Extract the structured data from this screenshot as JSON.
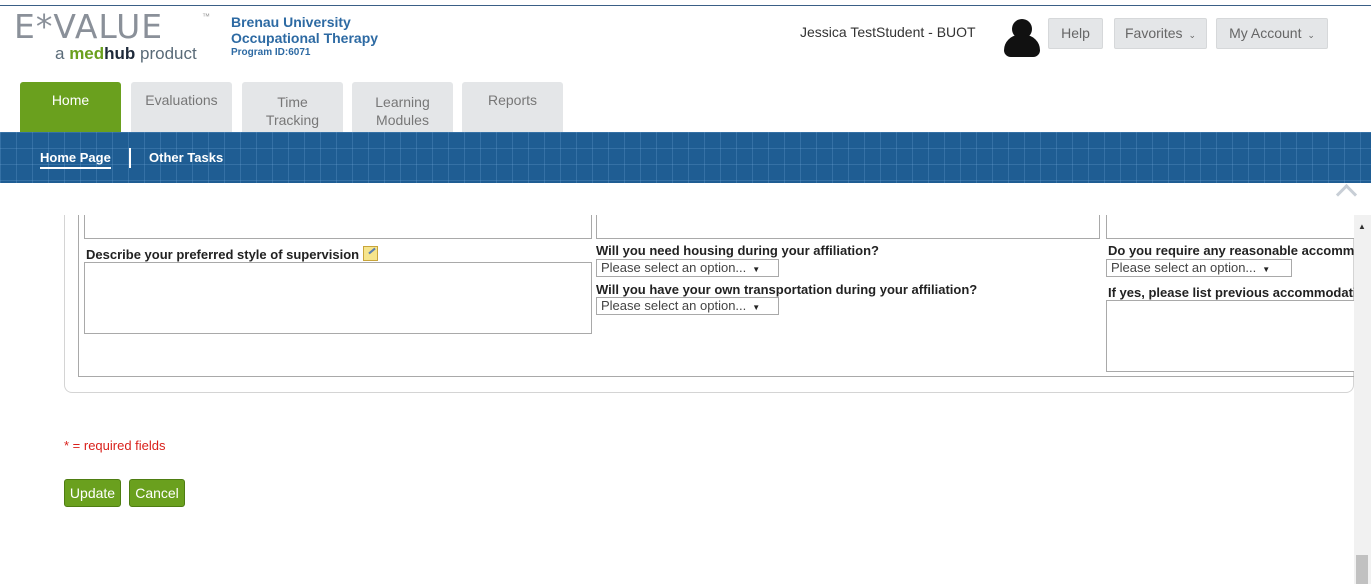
{
  "header": {
    "logo_main": "E*VALUE",
    "logo_tm": "™",
    "logo_sub_prefix": "a ",
    "logo_sub_med": "med",
    "logo_sub_hub": "hub",
    "logo_sub_suffix": " product",
    "program_line1": "Brenau University",
    "program_line2": "Occupational Therapy",
    "program_id": "Program ID:6071",
    "user_name": "Jessica TestStudent - BUOT",
    "help_label": "Help",
    "favorites_label": "Favorites",
    "account_label": "My Account",
    "chevron": "⌄"
  },
  "tabs": [
    {
      "line1": "Home",
      "line2": ""
    },
    {
      "line1": "Evaluations",
      "line2": ""
    },
    {
      "line1": "Time",
      "line2": "Tracking"
    },
    {
      "line1": "Learning",
      "line2": "Modules"
    },
    {
      "line1": "Reports",
      "line2": ""
    }
  ],
  "subnav": {
    "home_page": "Home Page",
    "other_tasks": "Other Tasks"
  },
  "form": {
    "supervision_label": "Describe your preferred style of supervision",
    "housing_label": "Will you need housing during your affiliation?",
    "housing_value": "Please select an option...",
    "transport_label": "Will you have your own transportation during your affiliation?",
    "transport_value": "Please select an option...",
    "accommodation_label": "Do you require any reasonable accommodations",
    "accommodation_value": "Please select an option...",
    "previous_label": "If yes, please list previous accommodations",
    "select_arrow": "▼"
  },
  "footer": {
    "required_note": "* = required fields",
    "update_label": "Update",
    "cancel_label": "Cancel"
  },
  "scroll_up_glyph": "▲"
}
